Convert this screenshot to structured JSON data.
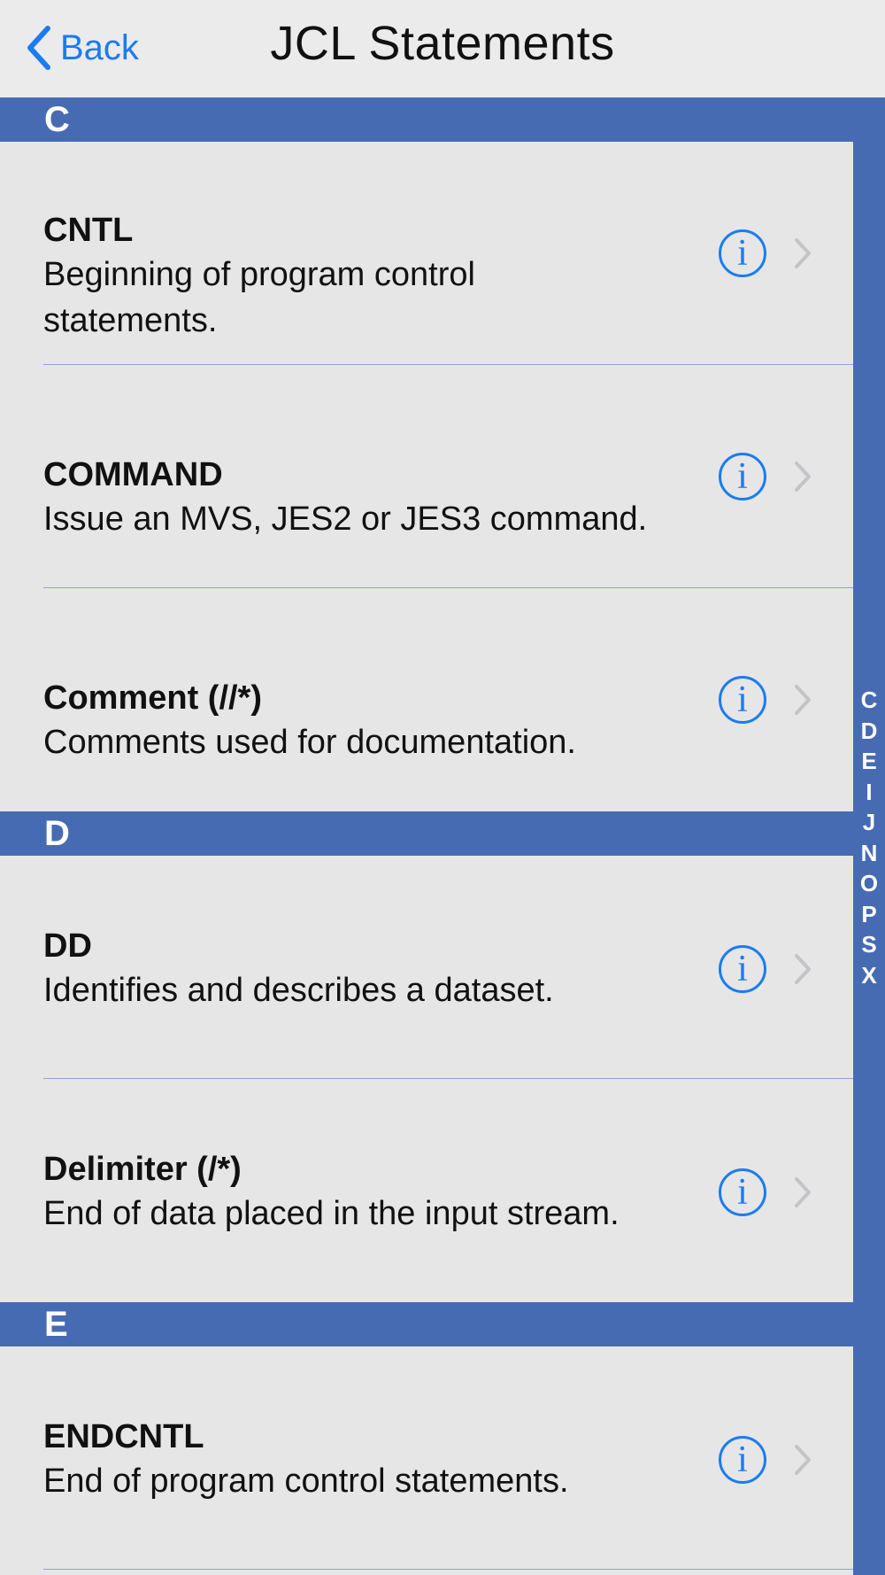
{
  "navbar": {
    "back_label": "Back",
    "title": "JCL Statements"
  },
  "sections": [
    {
      "letter": "C",
      "rows": [
        {
          "title": "CNTL",
          "desc_line1": "Beginning of program control",
          "desc_line2": "statements."
        },
        {
          "title": "COMMAND",
          "desc_line1": "Issue an MVS, JES2 or JES3 command.",
          "desc_line2": ""
        },
        {
          "title": "Comment (//*)",
          "desc_line1": "Comments used for documentation.",
          "desc_line2": ""
        }
      ]
    },
    {
      "letter": "D",
      "rows": [
        {
          "title": "DD",
          "desc_line1": "Identifies and describes a dataset.",
          "desc_line2": ""
        },
        {
          "title": "Delimiter (/*)",
          "desc_line1": "End of data placed in the input stream.",
          "desc_line2": ""
        }
      ]
    },
    {
      "letter": "E",
      "rows": [
        {
          "title": "ENDCNTL",
          "desc_line1": "End of program control statements.",
          "desc_line2": ""
        }
      ]
    }
  ],
  "index": [
    "C",
    "D",
    "E",
    "I",
    "J",
    "N",
    "O",
    "P",
    "S",
    "X"
  ],
  "icons": {
    "back": "chevron-left-icon",
    "info": "info-circle-icon",
    "disclosure": "chevron-right-icon",
    "info_glyph": "i"
  },
  "colors": {
    "accent": "#1a7cf0",
    "section_header": "#476bb2",
    "background": "#e6e6e6"
  }
}
